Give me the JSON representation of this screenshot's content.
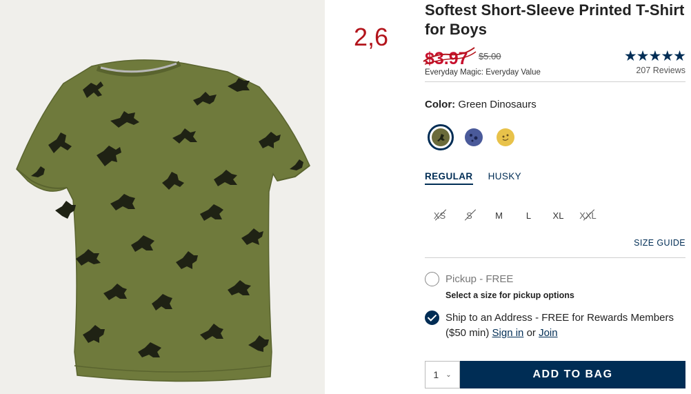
{
  "annotation": "2,6",
  "product": {
    "title": "Softest Short-Sleeve Printed T-Shirt for Boys",
    "sale_price": "$3.97",
    "original_price": "$5.00",
    "promo": "Everyday Magic: Everyday Value",
    "rating_stars": "★★★★★",
    "rating_value": 5,
    "reviews": "207 Reviews"
  },
  "color": {
    "label": "Color:",
    "selected": "Green Dinosaurs",
    "swatches": [
      {
        "name": "Green Dinosaurs",
        "color": "#6b6b3a"
      },
      {
        "name": "Blue Print",
        "color": "#4a5a9a"
      },
      {
        "name": "Yellow Print",
        "color": "#e8c24a"
      }
    ]
  },
  "fit": {
    "tabs": [
      "REGULAR",
      "HUSKY"
    ],
    "active": "REGULAR"
  },
  "sizes": [
    "XS",
    "S",
    "M",
    "L",
    "XL",
    "XXL"
  ],
  "size_guide": "SIZE GUIDE",
  "fulfillment": {
    "pickup_label": "Pickup - FREE",
    "pickup_note": "Select a size for pickup options",
    "ship_label": "Ship to an Address - FREE for Rewards Members ($50 min)",
    "sign_in": "Sign in",
    "or": "or",
    "join": "Join"
  },
  "bag": {
    "quantity": "1",
    "add_label": "ADD TO BAG"
  },
  "colors": {
    "navy": "#002d55",
    "sale_red": "#c8102e",
    "shirt_green": "#6f7a3c"
  }
}
